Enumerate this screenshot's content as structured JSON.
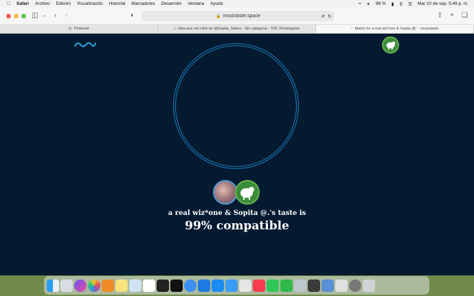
{
  "menubar": {
    "app": "Safari",
    "items": [
      "Archivo",
      "Edición",
      "Visualización",
      "Historial",
      "Marcadores",
      "Desarrollo",
      "Ventana",
      "Ayuda"
    ],
    "battery": "98 %",
    "datetime": "Mar 10 de sep.  5:49 p. m."
  },
  "browser": {
    "url": "musictaste.space",
    "tabs": [
      {
        "label": "Pinterest",
        "active": false
      },
      {
        "label": "Idea que me robé de @Sopita_Salero - Sin categoría - TOC Penstagram",
        "active": false
      },
      {
        "label": "Match for a real wiz*one & Sopita @.' - musictaste",
        "active": true
      }
    ]
  },
  "page": {
    "match_line": "a real wiz*one & Sopita @.'s taste is",
    "result": "99% compatible",
    "brand_color": "#1e7fbf",
    "background_color": "#041a30"
  },
  "dock": {
    "apps": [
      "finder-icon",
      "launchpad-icon",
      "siri-icon",
      "photos-icon",
      "books-icon",
      "notes-icon",
      "preview-icon",
      "reminders-icon",
      "capcut-icon",
      "capcut-alt-icon",
      "safari-icon",
      "xcode-icon",
      "app-store-icon",
      "mail-icon",
      "widgets-icon",
      "music-icon",
      "messages-icon",
      "facetime-icon",
      "keynote-icon",
      "sublime-icon",
      "downloads-icon",
      "tuneup-icon",
      "system-settings-icon",
      "trash-icon"
    ]
  }
}
